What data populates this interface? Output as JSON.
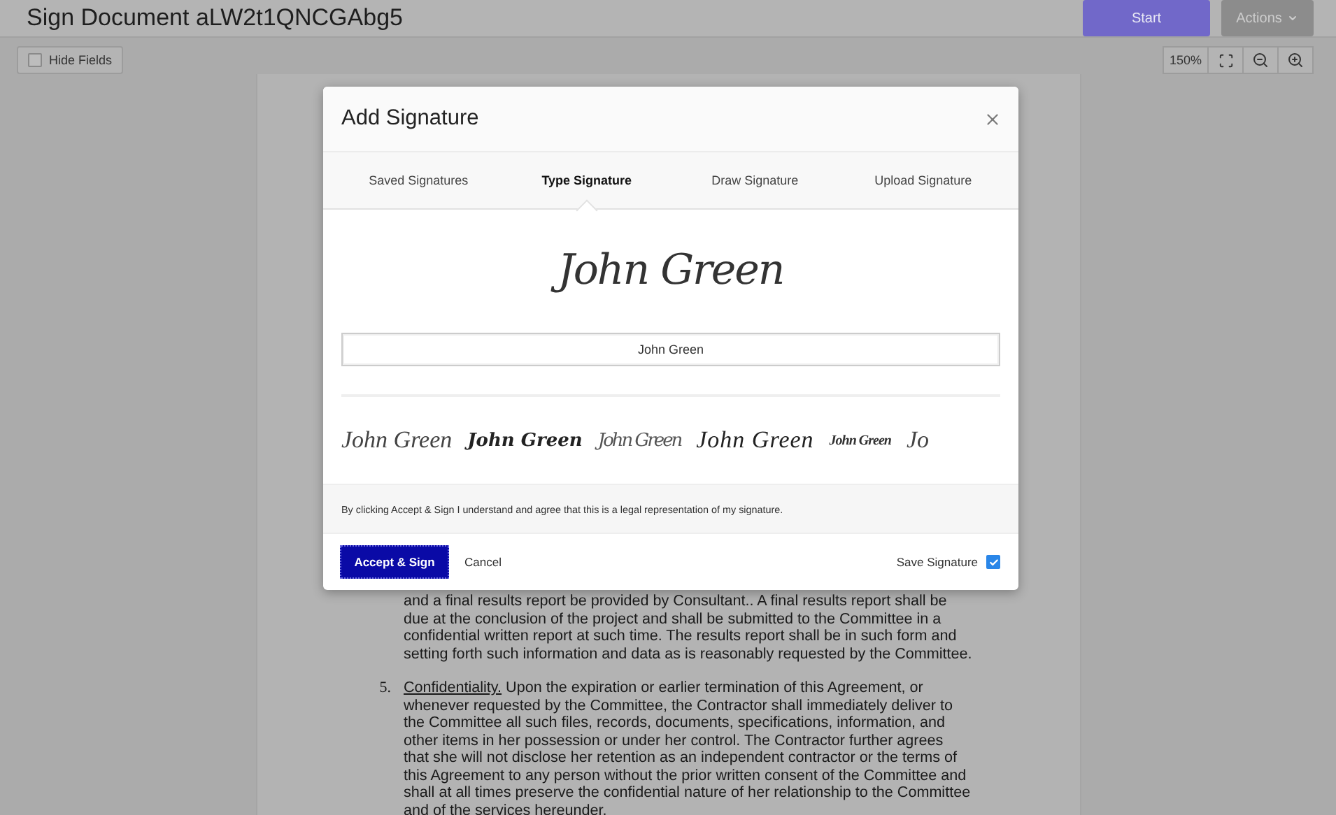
{
  "header": {
    "title": "Sign Document aLW2t1QNCGAbg5",
    "buttons": [
      {
        "label": "Start",
        "kind": "primary"
      },
      {
        "label": "Actions",
        "kind": "menu"
      }
    ]
  },
  "toolbar": {
    "hide_fields": {
      "label": "Hide Fields",
      "checked": false
    },
    "zoom": "150%"
  },
  "document": {
    "paragraphs": [
      {
        "lines": [
          "and a final results report be provided by Consultant..  A final results report shall be",
          "due at the conclusion of the project and shall be submitted to the Committee in a",
          "confidential written report at such time. The results report shall be in such form and",
          "setting forth such information and data as is reasonably requested by the Committee."
        ]
      },
      {
        "number": "5.",
        "heading": "Confidentiality.",
        "lines": [
          "Upon the expiration or earlier termination of this Agreement, or",
          "whenever requested by the Committee, the Contractor shall immediately deliver to",
          "the Committee all such files, records, documents, specifications, information, and",
          "other items in her possession or under her control.  The Contractor further agrees",
          "that she will not disclose her retention as an independent contractor or the terms of",
          "this Agreement to any person without the prior written consent of the Committee and",
          "shall at all times preserve the confidential nature of her relationship to the Committee",
          "and of the services hereunder."
        ]
      }
    ]
  },
  "dialog": {
    "title": "Add Signature",
    "tabs": [
      {
        "label": "Saved Signatures",
        "selected": false
      },
      {
        "label": "Type Signature",
        "selected": true
      },
      {
        "label": "Draw Signature",
        "selected": false
      },
      {
        "label": "Upload Signature",
        "selected": false
      }
    ],
    "preview": "John Green",
    "name_input": {
      "value": "John Green"
    },
    "styles": [
      {
        "text": "John Green",
        "kind": "thin"
      },
      {
        "text": "John Green",
        "kind": "bold"
      },
      {
        "text": "John Green",
        "kind": "narrow"
      },
      {
        "text": "John Green",
        "kind": "wide"
      },
      {
        "text": "John Green",
        "kind": "small"
      },
      {
        "text": "Jo",
        "kind": "thin"
      }
    ],
    "disclaimer": "By clicking Accept & Sign I understand and agree that this is a legal representation of my signature.",
    "accept_button": "Accept & Sign",
    "cancel_button": "Cancel",
    "save_signature": {
      "label": "Save Signature",
      "checked": true
    }
  }
}
